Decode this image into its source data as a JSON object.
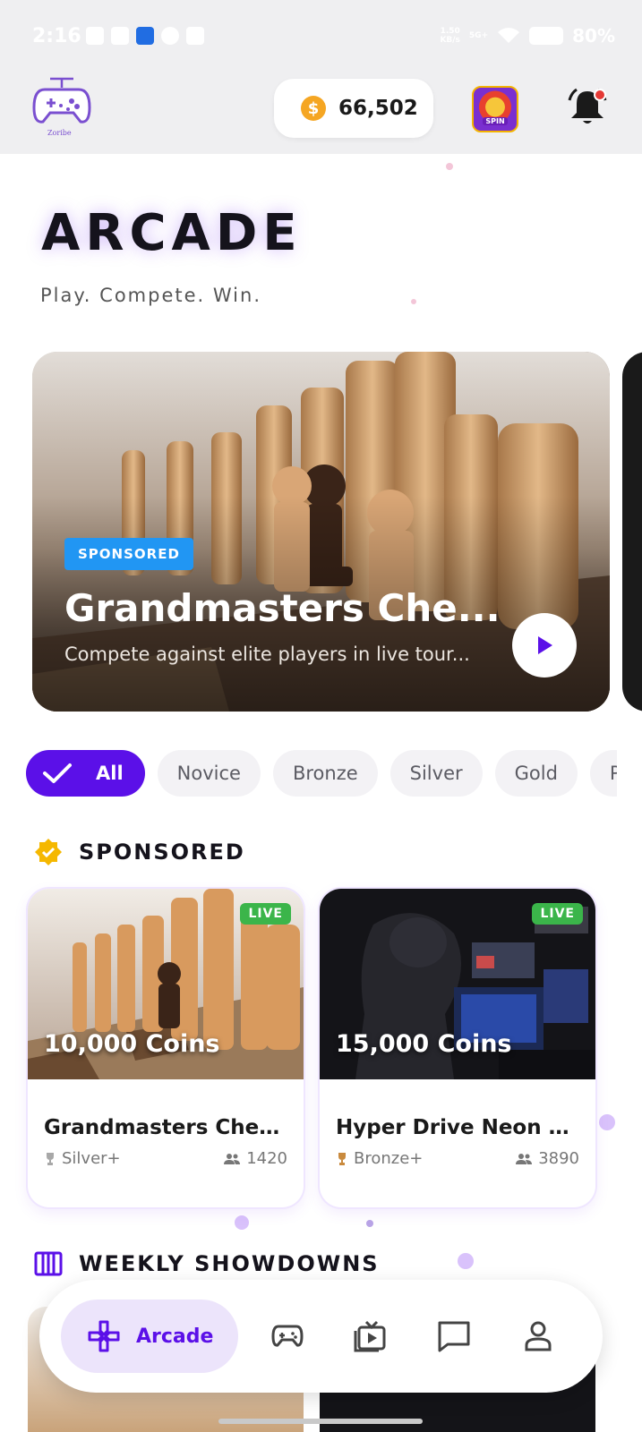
{
  "status_bar": {
    "time": "2:16",
    "net_speed": "1.50\nKB/s",
    "net_type": "5G+",
    "battery": "80%"
  },
  "header": {
    "logo_text": "Zoribe",
    "coins": "66,502",
    "spin_label": "SPIN"
  },
  "hero": {
    "title": "ARCADE",
    "subtitle": "Play. Compete. Win."
  },
  "featured": {
    "badge": "SPONSORED",
    "title": "Grandmasters Che...",
    "description": "Compete against elite players in live tour..."
  },
  "filters": [
    {
      "label": "All",
      "active": true
    },
    {
      "label": "Novice"
    },
    {
      "label": "Bronze"
    },
    {
      "label": "Silver"
    },
    {
      "label": "Gold"
    },
    {
      "label": "Pla"
    }
  ],
  "sections": {
    "sponsored": "SPONSORED",
    "weekly": "WEEKLY SHOWDOWNS"
  },
  "games": [
    {
      "live": "LIVE",
      "prize": "10,000 Coins",
      "name": "Grandmasters Ches...",
      "tier": "Silver+",
      "players": "1420"
    },
    {
      "live": "LIVE",
      "prize": "15,000 Coins",
      "name": "Hyper Drive Neon S...",
      "tier": "Bronze+",
      "players": "3890"
    }
  ],
  "nav": {
    "active_label": "Arcade",
    "items": [
      "gamepad-icon",
      "video-library-icon",
      "chat-icon",
      "profile-icon"
    ]
  },
  "colors": {
    "accent": "#5b10e8",
    "live": "#3bb54a",
    "sponsored_badge": "#2196f3",
    "coin": "#f5a623"
  }
}
